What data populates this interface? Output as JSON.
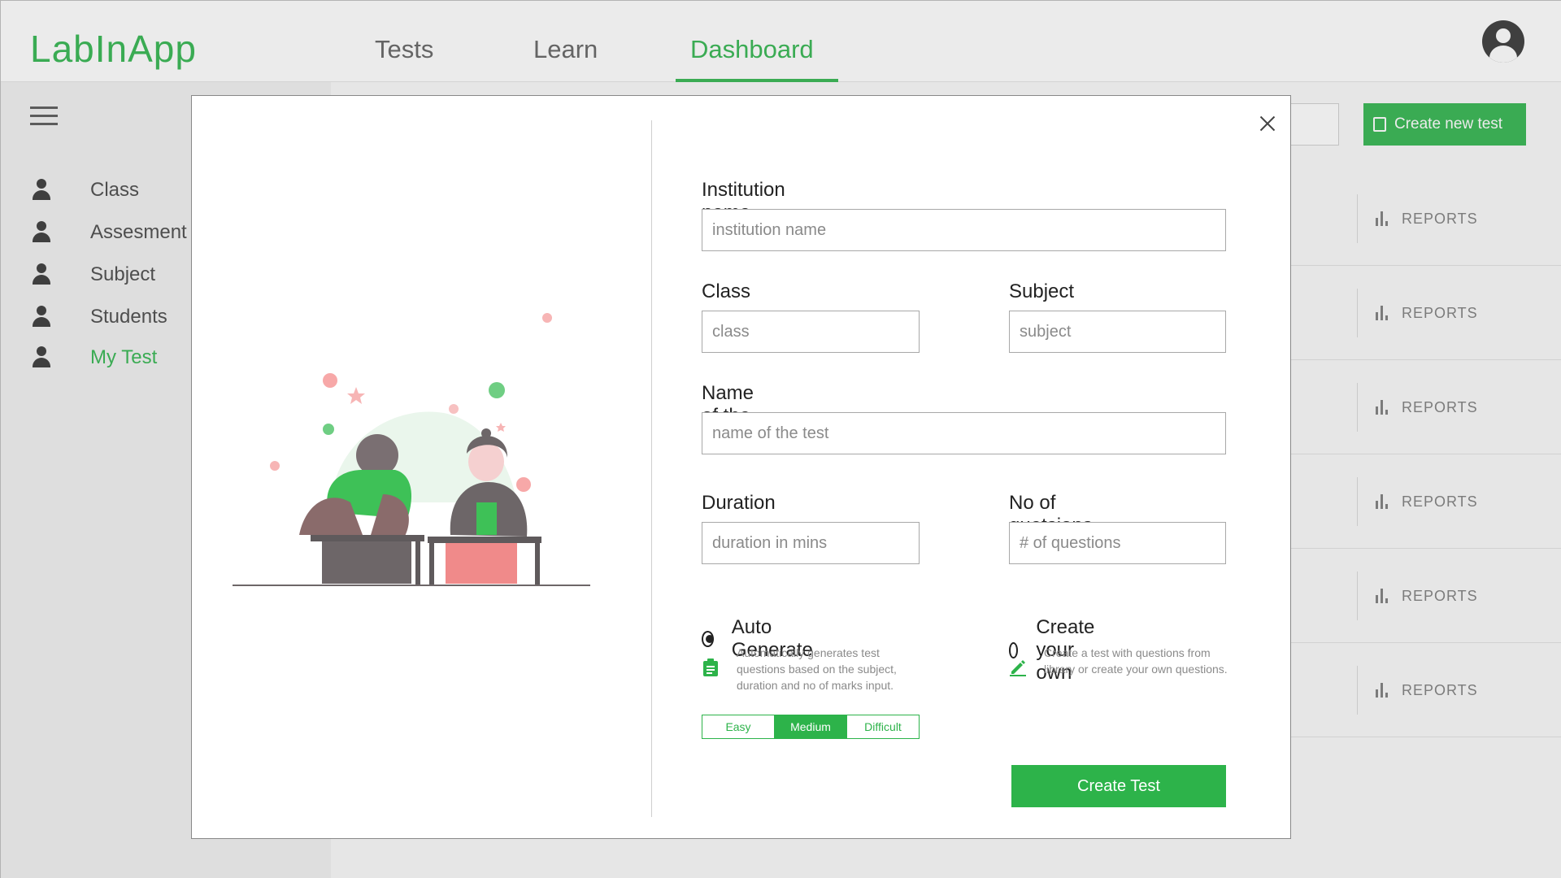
{
  "app": {
    "logo": "LabInApp",
    "nav": [
      "Tests",
      "Learn",
      "Dashboard"
    ],
    "active_nav": "Dashboard",
    "accent_color": "#2db34a"
  },
  "sidebar": {
    "items": [
      {
        "label": "Class",
        "icon": "user-icon"
      },
      {
        "label": "Assesment",
        "icon": "user-icon"
      },
      {
        "label": "Subject",
        "icon": "user-icon"
      },
      {
        "label": "Students",
        "icon": "user-icon"
      },
      {
        "label": "My Test",
        "icon": "user-icon",
        "active": true
      }
    ]
  },
  "content": {
    "create_button": "Create new test",
    "reports_label": "REPORTS"
  },
  "modal": {
    "institution": {
      "label": "Institution name",
      "placeholder": "institution name"
    },
    "class": {
      "label": "Class",
      "placeholder": "class"
    },
    "subject": {
      "label": "Subject",
      "placeholder": "subject"
    },
    "test_name": {
      "label": "Name of the test",
      "placeholder": "name of the test"
    },
    "duration": {
      "label": "Duration",
      "placeholder": "duration in mins"
    },
    "questions": {
      "label": "No of quetsions",
      "placeholder": "# of questions"
    },
    "auto": {
      "title": "Auto Generate",
      "description": "Automatically generates test questions based on the subject, duration and no of marks input.",
      "selected": true
    },
    "own": {
      "title": "Create your own",
      "description": "Create a test with questions from library or create your own questions.",
      "selected": false
    },
    "difficulty": {
      "options": [
        "Easy",
        "Medium",
        "Difficult"
      ],
      "selected": "Medium"
    },
    "submit_label": "Create Test"
  }
}
